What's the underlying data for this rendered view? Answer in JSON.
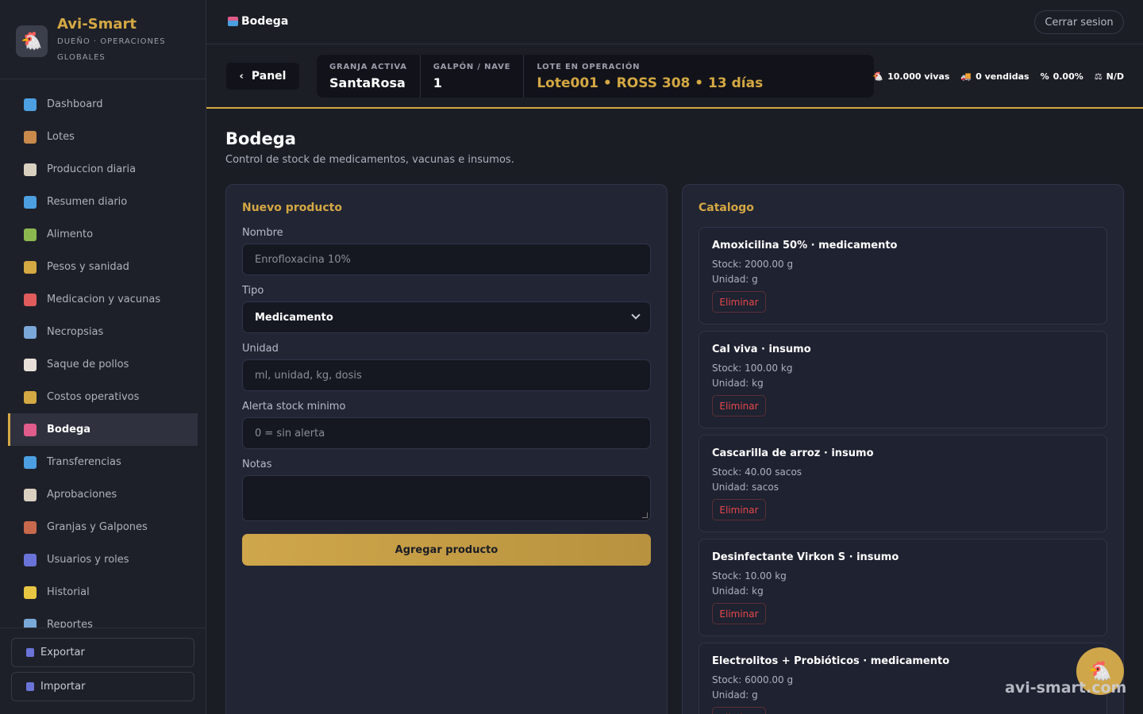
{
  "brand": {
    "name": "Avi-Smart",
    "subtitle": "DUEÑO · OPERACIONES GLOBALES"
  },
  "sidebar": {
    "items": [
      {
        "label": "Dashboard",
        "icon": "bar-chart-icon",
        "color": "#4c9fe0"
      },
      {
        "label": "Lotes",
        "icon": "box-icon",
        "color": "#c98a4b"
      },
      {
        "label": "Produccion diaria",
        "icon": "clipboard-icon",
        "color": "#d9d0c0"
      },
      {
        "label": "Resumen diario",
        "icon": "bar-chart-icon",
        "color": "#4c9fe0"
      },
      {
        "label": "Alimento",
        "icon": "corn-icon",
        "color": "#8ab84f"
      },
      {
        "label": "Pesos y sanidad",
        "icon": "scale-icon",
        "color": "#d4a843"
      },
      {
        "label": "Medicacion y vacunas",
        "icon": "pill-icon",
        "color": "#e05c5c"
      },
      {
        "label": "Necropsias",
        "icon": "microscope-icon",
        "color": "#7aa8d8"
      },
      {
        "label": "Saque de pollos",
        "icon": "chicken-icon",
        "color": "#e8e0d8"
      },
      {
        "label": "Costos operativos",
        "icon": "money-bag-icon",
        "color": "#d4a843"
      },
      {
        "label": "Bodega",
        "icon": "store-icon",
        "color": "#e05c8a",
        "active": true
      },
      {
        "label": "Transferencias",
        "icon": "transfer-icon",
        "color": "#4c9fe0"
      },
      {
        "label": "Aprobaciones",
        "icon": "clipboard-icon",
        "color": "#d9d0c0"
      },
      {
        "label": "Granjas y Galpones",
        "icon": "barn-icon",
        "color": "#c9694b"
      },
      {
        "label": "Usuarios y roles",
        "icon": "users-icon",
        "color": "#6a74d8"
      },
      {
        "label": "Historial",
        "icon": "folder-icon",
        "color": "#e8c542"
      },
      {
        "label": "Reportes",
        "icon": "chart-icon",
        "color": "#7aa8d8"
      }
    ],
    "export_label": "Exportar",
    "import_label": "Importar"
  },
  "topbar": {
    "title": "Bodega",
    "logout_label": "Cerrar sesion"
  },
  "context": {
    "panel_label": "Panel",
    "farm_label": "GRANJA ACTIVA",
    "farm_value": "SantaRosa",
    "shed_label": "GALPÓN / NAVE",
    "shed_value": "1",
    "lot_label": "LOTE EN OPERACIÓN",
    "lot_value": "Lote001 • ROSS 308 • 13 días",
    "stats": [
      {
        "icon": "chicken-icon",
        "text": "10.000 vivas"
      },
      {
        "icon": "truck-icon",
        "text": "0 vendidas"
      },
      {
        "icon": "percent-icon",
        "text": "0.00%"
      },
      {
        "icon": "scale-icon",
        "text": "N/D"
      }
    ]
  },
  "page": {
    "title": "Bodega",
    "subtitle": "Control de stock de medicamentos, vacunas e insumos."
  },
  "form": {
    "title": "Nuevo producto",
    "name_label": "Nombre",
    "name_placeholder": "Enrofloxacina 10%",
    "type_label": "Tipo",
    "type_value": "Medicamento",
    "unit_label": "Unidad",
    "unit_placeholder": "ml, unidad, kg, dosis",
    "alert_label": "Alerta stock minimo",
    "alert_placeholder": "0 = sin alerta",
    "notes_label": "Notas",
    "submit_label": "Agregar producto"
  },
  "catalog": {
    "title": "Catalogo",
    "delete_label": "Eliminar",
    "items": [
      {
        "name": "Amoxicilina 50% · medicamento",
        "stock": "Stock: 2000.00 g",
        "unit": "Unidad: g"
      },
      {
        "name": "Cal viva · insumo",
        "stock": "Stock: 100.00 kg",
        "unit": "Unidad: kg"
      },
      {
        "name": "Cascarilla de arroz · insumo",
        "stock": "Stock: 40.00 sacos",
        "unit": "Unidad: sacos"
      },
      {
        "name": "Desinfectante Virkon S · insumo",
        "stock": "Stock: 10.00 kg",
        "unit": "Unidad: kg"
      },
      {
        "name": "Electrolitos + Probióticos · medicamento",
        "stock": "Stock: 6000.00 g",
        "unit": "Unidad: g"
      }
    ]
  },
  "watermark": "avi-smart.com",
  "colors": {
    "accent": "#d4a843",
    "danger": "#e5484d",
    "background": "#1b1d25"
  }
}
